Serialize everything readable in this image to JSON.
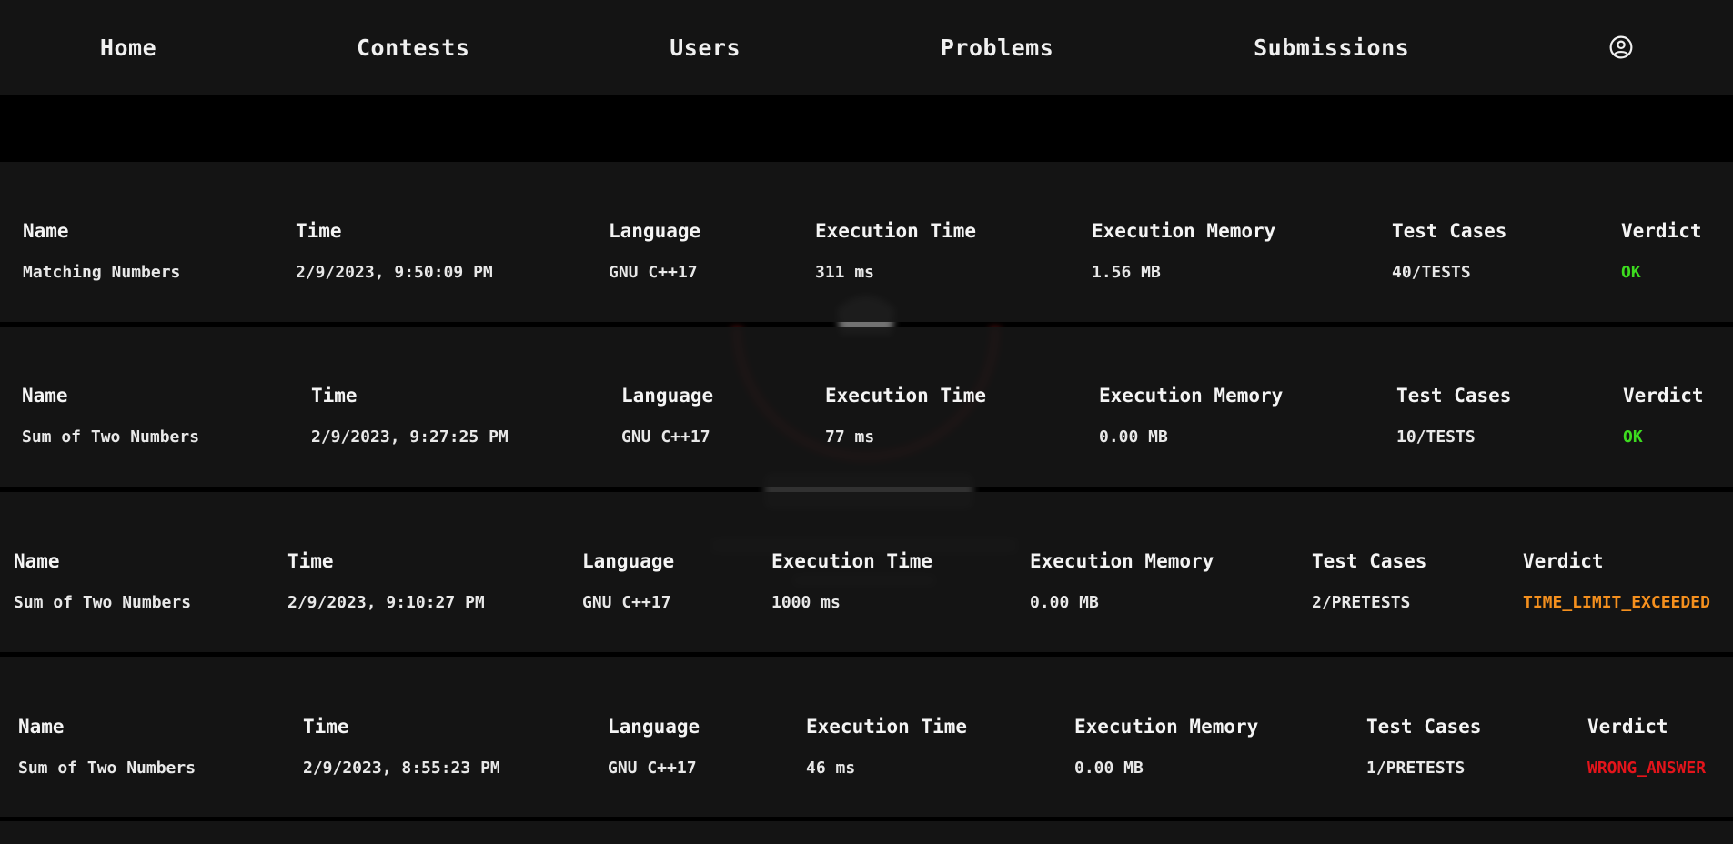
{
  "nav": {
    "items": [
      "Home",
      "Contests",
      "Users",
      "Problems",
      "Submissions"
    ],
    "profile_icon": "user-circle-icon"
  },
  "headers": {
    "name": "Name",
    "time": "Time",
    "language": "Language",
    "exec_time": "Execution Time",
    "exec_memory": "Execution Memory",
    "test_cases": "Test Cases",
    "verdict": "Verdict"
  },
  "submissions": [
    {
      "name": "Matching Numbers",
      "time": "2/9/2023, 9:50:09 PM",
      "language": "GNU C++17",
      "exec_time": "311 ms",
      "exec_memory": "1.56 MB",
      "test_cases": "40/TESTS",
      "verdict": "OK",
      "verdict_color": "#3ddc1f"
    },
    {
      "name": "Sum of Two Numbers",
      "time": "2/9/2023, 9:27:25 PM",
      "language": "GNU C++17",
      "exec_time": "77 ms",
      "exec_memory": "0.00 MB",
      "test_cases": "10/TESTS",
      "verdict": "OK",
      "verdict_color": "#3ddc1f"
    },
    {
      "name": "Sum of Two Numbers",
      "time": "2/9/2023, 9:10:27 PM",
      "language": "GNU C++17",
      "exec_time": "1000 ms",
      "exec_memory": "0.00 MB",
      "test_cases": "2/PRETESTS",
      "verdict": "TIME_LIMIT_EXCEEDED",
      "verdict_color": "#f5901e"
    },
    {
      "name": "Sum of Two Numbers",
      "time": "2/9/2023, 8:55:23 PM",
      "language": "GNU C++17",
      "exec_time": "46 ms",
      "exec_memory": "0.00 MB",
      "test_cases": "1/PRETESTS",
      "verdict": "WRONG_ANSWER",
      "verdict_color": "#e3141b"
    }
  ],
  "colors": {
    "navbar_bg": "#141414",
    "row_bg": "#161616",
    "accent": "#c62828"
  }
}
